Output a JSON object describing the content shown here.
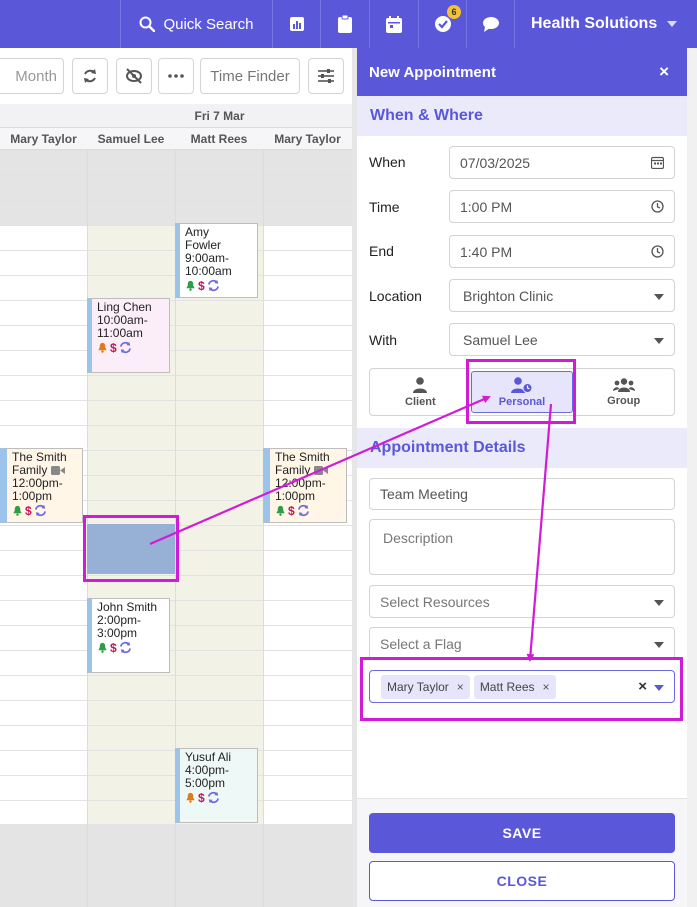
{
  "topbar": {
    "search_label": "Quick Search",
    "notification_count": "6",
    "org_name": "Health Solutions",
    "icons": [
      "reports-icon",
      "clipboard-icon",
      "calendar-icon",
      "tasks-icon",
      "chat-icon"
    ]
  },
  "toolbar": {
    "view_label": "Month",
    "time_finder_label": "Time Finder"
  },
  "calendar": {
    "day_label": "Fri 7 Mar",
    "resources": [
      "Mary Taylor",
      "Samuel Lee",
      "Matt Rees",
      "Mary Taylor"
    ],
    "appointments": [
      {
        "name": "Amy Fowler",
        "line1": "Amy",
        "line2": "Fowler",
        "time1": "9:00am-",
        "time2": "10:00am",
        "bell_color": "#2e9e44"
      },
      {
        "name": "Ling Chen",
        "line1": "Ling Chen",
        "time1": "10:00am-",
        "time2": "11:00am",
        "bell_color": "#e07b1a"
      },
      {
        "name": "The Smith Family",
        "line1": "The Smith",
        "line2": "Family",
        "time1": "12:00pm-",
        "time2": "1:00pm",
        "bell_color": "#2e9e44"
      },
      {
        "name": "The Smith Family",
        "line1": "The Smith",
        "line2": "Family",
        "time1": "12:00pm-",
        "time2": "1:00pm",
        "bell_color": "#2e9e44"
      },
      {
        "name": "John Smith",
        "line1": "John Smith",
        "time1": "2:00pm-",
        "time2": "3:00pm",
        "bell_color": "#2e9e44"
      },
      {
        "name": "Yusuf Ali",
        "line1": "Yusuf Ali",
        "time1": "4:00pm-",
        "time2": "5:00pm",
        "bell_color": "#e07b1a"
      }
    ]
  },
  "panel": {
    "title": "New Appointment",
    "close_symbol": "×",
    "when_where_heading": "When & Where",
    "when_label": "When",
    "when_value": "07/03/2025",
    "time_label": "Time",
    "time_value": "1:00 PM",
    "end_label": "End",
    "end_value": "1:40 PM",
    "location_label": "Location",
    "location_value": "Brighton Clinic",
    "with_label": "With",
    "with_value": "Samuel Lee",
    "types": [
      "Client",
      "Personal",
      "Group"
    ],
    "active_type": "Personal",
    "details_heading": "Appointment Details",
    "title_value": "Team Meeting",
    "description_placeholder": "Description",
    "resources_placeholder": "Select Resources",
    "flag_placeholder": "Select a Flag",
    "attendees": [
      "Mary Taylor",
      "Matt Rees"
    ],
    "save_label": "SAVE",
    "close_label": "CLOSE"
  },
  "colors": {
    "primary": "#5b57d9",
    "annotation": "#d21bd6",
    "selection": "#97b0d6",
    "dollar": "#c2185b"
  }
}
